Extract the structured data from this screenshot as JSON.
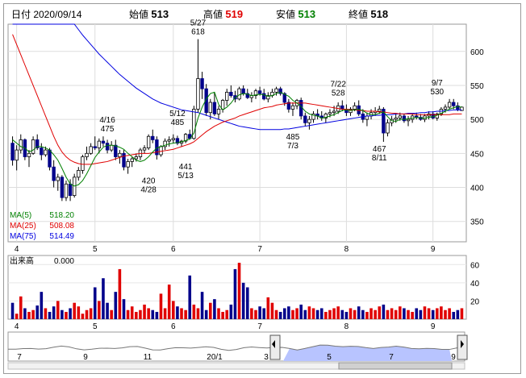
{
  "header": {
    "date_label": "日付 2020/09/14",
    "open_label": "始値",
    "open_value": "513",
    "high_label": "高値",
    "high_value": "519",
    "low_label": "安値",
    "low_value": "513",
    "close_label": "終値",
    "close_value": "518"
  },
  "colors": {
    "ma5": "#008000",
    "ma25": "#e00000",
    "ma75": "#0000e0",
    "up": "#e00000",
    "down": "#00008b",
    "flat": "#999999"
  },
  "chart_data": [
    {
      "type": "candlestick",
      "y_ticks": [
        350,
        400,
        450,
        500,
        550,
        600
      ],
      "ylim": [
        320,
        640
      ],
      "x_ticks": [
        "4",
        "5",
        "6",
        "7",
        "8",
        "9"
      ],
      "legend": [
        {
          "name": "MA(5)",
          "value": "518.20"
        },
        {
          "name": "MA(25)",
          "value": "508.08"
        },
        {
          "name": "MA(75)",
          "value": "514.49"
        }
      ],
      "annotations": [
        {
          "date": "4/16",
          "value": "475",
          "y": 475
        },
        {
          "date": "4/28",
          "value": "420",
          "y": 420
        },
        {
          "date": "5/12",
          "value": "485",
          "y": 485
        },
        {
          "date": "5/13",
          "value": "441",
          "y": 441
        },
        {
          "date": "5/27",
          "value": "618",
          "y": 618
        },
        {
          "date": "7/3",
          "value": "485",
          "y": 485
        },
        {
          "date": "7/22",
          "value": "528",
          "y": 528
        },
        {
          "date": "8/11",
          "value": "467",
          "y": 467
        },
        {
          "date": "9/7",
          "value": "530",
          "y": 530
        }
      ],
      "candles": [
        [
          465,
          475,
          432,
          440
        ],
        [
          440,
          462,
          425,
          455
        ],
        [
          455,
          478,
          450,
          470
        ],
        [
          470,
          472,
          440,
          445
        ],
        [
          445,
          455,
          430,
          450
        ],
        [
          450,
          475,
          448,
          470
        ],
        [
          470,
          478,
          455,
          458
        ],
        [
          458,
          465,
          440,
          448
        ],
        [
          448,
          460,
          445,
          455
        ],
        [
          455,
          458,
          425,
          430
        ],
        [
          430,
          440,
          400,
          410
        ],
        [
          410,
          420,
          395,
          415
        ],
        [
          415,
          418,
          380,
          385
        ],
        [
          385,
          410,
          380,
          405
        ],
        [
          405,
          412,
          380,
          388
        ],
        [
          388,
          420,
          385,
          415
        ],
        [
          415,
          430,
          410,
          425
        ],
        [
          425,
          448,
          420,
          445
        ],
        [
          445,
          460,
          440,
          450
        ],
        [
          450,
          465,
          448,
          460
        ],
        [
          460,
          475,
          455,
          458
        ],
        [
          458,
          472,
          450,
          468
        ],
        [
          468,
          475,
          460,
          465
        ],
        [
          465,
          470,
          450,
          455
        ],
        [
          455,
          468,
          452,
          462
        ],
        [
          462,
          470,
          440,
          445
        ],
        [
          445,
          455,
          435,
          450
        ],
        [
          450,
          455,
          425,
          430
        ],
        [
          430,
          442,
          420,
          438
        ],
        [
          438,
          445,
          430,
          442
        ],
        [
          442,
          450,
          438,
          445
        ],
        [
          445,
          458,
          440,
          455
        ],
        [
          455,
          462,
          450,
          458
        ],
        [
          458,
          478,
          455,
          475
        ],
        [
          475,
          485,
          465,
          470
        ],
        [
          470,
          475,
          441,
          448
        ],
        [
          448,
          462,
          445,
          460
        ],
        [
          460,
          472,
          455,
          468
        ],
        [
          468,
          475,
          460,
          470
        ],
        [
          470,
          478,
          465,
          472
        ],
        [
          472,
          476,
          462,
          465
        ],
        [
          465,
          470,
          460,
          468
        ],
        [
          468,
          480,
          465,
          478
        ],
        [
          478,
          485,
          470,
          472
        ],
        [
          472,
          520,
          470,
          515
        ],
        [
          515,
          618,
          510,
          560
        ],
        [
          560,
          570,
          530,
          545
        ],
        [
          545,
          552,
          505,
          510
        ],
        [
          510,
          530,
          500,
          525
        ],
        [
          525,
          540,
          505,
          508
        ],
        [
          508,
          520,
          500,
          515
        ],
        [
          515,
          530,
          510,
          528
        ],
        [
          528,
          545,
          520,
          540
        ],
        [
          540,
          550,
          532,
          535
        ],
        [
          535,
          542,
          525,
          530
        ],
        [
          530,
          548,
          528,
          545
        ],
        [
          545,
          550,
          535,
          538
        ],
        [
          538,
          545,
          530,
          532
        ],
        [
          532,
          540,
          525,
          535
        ],
        [
          535,
          545,
          530,
          542
        ],
        [
          542,
          548,
          535,
          538
        ],
        [
          538,
          545,
          528,
          530
        ],
        [
          530,
          540,
          525,
          535
        ],
        [
          535,
          545,
          532,
          540
        ],
        [
          540,
          548,
          535,
          545
        ],
        [
          545,
          548,
          535,
          538
        ],
        [
          538,
          540,
          520,
          525
        ],
        [
          525,
          530,
          510,
          515
        ],
        [
          515,
          525,
          505,
          520
        ],
        [
          520,
          530,
          515,
          528
        ],
        [
          528,
          532,
          500,
          505
        ],
        [
          505,
          510,
          490,
          495
        ],
        [
          495,
          505,
          485,
          500
        ],
        [
          500,
          512,
          495,
          508
        ],
        [
          508,
          515,
          500,
          505
        ],
        [
          505,
          512,
          498,
          502
        ],
        [
          502,
          510,
          495,
          508
        ],
        [
          508,
          515,
          503,
          510
        ],
        [
          510,
          520,
          505,
          512
        ],
        [
          512,
          525,
          508,
          520
        ],
        [
          520,
          528,
          512,
          515
        ],
        [
          515,
          522,
          505,
          510
        ],
        [
          510,
          518,
          505,
          515
        ],
        [
          515,
          525,
          512,
          520
        ],
        [
          520,
          528,
          505,
          508
        ],
        [
          508,
          515,
          495,
          500
        ],
        [
          500,
          510,
          490,
          505
        ],
        [
          505,
          515,
          500,
          510
        ],
        [
          510,
          518,
          505,
          512
        ],
        [
          512,
          520,
          508,
          515
        ],
        [
          515,
          518,
          467,
          480
        ],
        [
          480,
          500,
          475,
          495
        ],
        [
          495,
          505,
          490,
          500
        ],
        [
          500,
          508,
          495,
          502
        ],
        [
          502,
          510,
          498,
          505
        ],
        [
          505,
          508,
          495,
          498
        ],
        [
          498,
          505,
          490,
          500
        ],
        [
          500,
          508,
          495,
          505
        ],
        [
          505,
          510,
          500,
          503
        ],
        [
          503,
          508,
          498,
          500
        ],
        [
          500,
          508,
          496,
          505
        ],
        [
          505,
          512,
          500,
          508
        ],
        [
          508,
          512,
          500,
          502
        ],
        [
          502,
          510,
          498,
          508
        ],
        [
          508,
          518,
          505,
          515
        ],
        [
          515,
          522,
          510,
          518
        ],
        [
          518,
          530,
          515,
          525
        ],
        [
          525,
          530,
          515,
          520
        ],
        [
          520,
          525,
          512,
          515
        ],
        [
          513,
          519,
          513,
          518
        ]
      ],
      "ma5": [
        470,
        465,
        460,
        458,
        452,
        455,
        460,
        460,
        458,
        455,
        448,
        440,
        428,
        415,
        405,
        402,
        404,
        410,
        420,
        432,
        444,
        452,
        459,
        462,
        462,
        461,
        459,
        456,
        450,
        445,
        440,
        438,
        440,
        445,
        452,
        458,
        460,
        462,
        464,
        465,
        466,
        467,
        469,
        471,
        480,
        502,
        518,
        530,
        538,
        540,
        522,
        514,
        518,
        524,
        532,
        536,
        538,
        537,
        535,
        536,
        537,
        536,
        534,
        535,
        538,
        540,
        537,
        534,
        528,
        524,
        519,
        512,
        508,
        506,
        505,
        502,
        503,
        505,
        507,
        510,
        513,
        514,
        513,
        514,
        515,
        513,
        509,
        507,
        507,
        509,
        511,
        504,
        498,
        497,
        500,
        500,
        501,
        502,
        503,
        502,
        502,
        503,
        504,
        506,
        509,
        512,
        515,
        517,
        519,
        518
      ],
      "ma25": [
        625,
        610,
        595,
        580,
        565,
        550,
        535,
        520,
        505,
        490,
        475,
        462,
        452,
        445,
        440,
        437,
        435,
        434,
        434,
        434,
        435,
        436,
        437,
        438,
        440,
        442,
        444,
        446,
        447,
        448,
        449,
        450,
        450,
        450,
        451,
        452,
        453,
        454,
        455,
        456,
        458,
        460,
        462,
        464,
        467,
        472,
        477,
        482,
        486,
        490,
        493,
        496,
        498,
        500,
        502,
        505,
        507,
        509,
        511,
        513,
        515,
        517,
        518,
        519,
        521,
        522,
        523,
        524,
        524,
        524,
        524,
        524,
        523,
        522,
        521,
        520,
        519,
        518,
        517,
        516,
        515,
        515,
        514,
        514,
        513,
        513,
        512,
        512,
        512,
        511,
        511,
        510,
        509,
        509,
        508,
        508,
        508,
        508,
        507,
        507,
        507,
        507,
        507,
        507,
        507,
        507,
        507,
        508,
        508,
        508
      ],
      "ma75": [
        760,
        752,
        744,
        736,
        728,
        720,
        712,
        704,
        696,
        688,
        680,
        672,
        664,
        656,
        648,
        640,
        632,
        624,
        617,
        610,
        603,
        596,
        590,
        584,
        578,
        572,
        566,
        561,
        556,
        551,
        546,
        542,
        538,
        534,
        530,
        527,
        524,
        522,
        520,
        518,
        516,
        514,
        513,
        512,
        511,
        510,
        508,
        506,
        504,
        502,
        500,
        498,
        496,
        494,
        492,
        490,
        489,
        488,
        487,
        486,
        485,
        485,
        485,
        485,
        485,
        485,
        486,
        486,
        487,
        488,
        489,
        490,
        491,
        492,
        493,
        494,
        495,
        496,
        497,
        498,
        499,
        500,
        501,
        502,
        503,
        504,
        505,
        505,
        506,
        506,
        507,
        507,
        507,
        508,
        508,
        508,
        509,
        509,
        509,
        510,
        510,
        511,
        511,
        512,
        512,
        513,
        513,
        514,
        514,
        514
      ],
      "volume_title": "出来高",
      "volume_current": "0.000",
      "volume_ticks": [
        20,
        40,
        60
      ],
      "volume_ylim": [
        0,
        70
      ],
      "volume": [
        18,
        6,
        25,
        12,
        8,
        10,
        15,
        30,
        12,
        8,
        14,
        20,
        10,
        8,
        12,
        18,
        14,
        6,
        10,
        12,
        35,
        20,
        45,
        18,
        10,
        30,
        55,
        22,
        10,
        14,
        8,
        10,
        16,
        12,
        10,
        8,
        28,
        12,
        38,
        20,
        14,
        12,
        10,
        48,
        16,
        12,
        30,
        10,
        18,
        22,
        12,
        8,
        10,
        16,
        55,
        62,
        40,
        35,
        12,
        10,
        14,
        12,
        24,
        18,
        10,
        8,
        12,
        14,
        10,
        12,
        16,
        10,
        14,
        12,
        10,
        12,
        8,
        10,
        12,
        14,
        10,
        8,
        12,
        10,
        14,
        10,
        8,
        12,
        10,
        14,
        16,
        10,
        12,
        10,
        14,
        12,
        10,
        8,
        12,
        10,
        14,
        12,
        10,
        12,
        14,
        10,
        12,
        8,
        10,
        12
      ],
      "volume_x_ticks": [
        "4",
        "5",
        "6",
        "7",
        "8",
        "9"
      ]
    },
    {
      "type": "area",
      "name": "period-selector",
      "x_ticks": [
        "7",
        "9",
        "11",
        "20/1",
        "3",
        "5",
        "7",
        "9"
      ]
    }
  ]
}
